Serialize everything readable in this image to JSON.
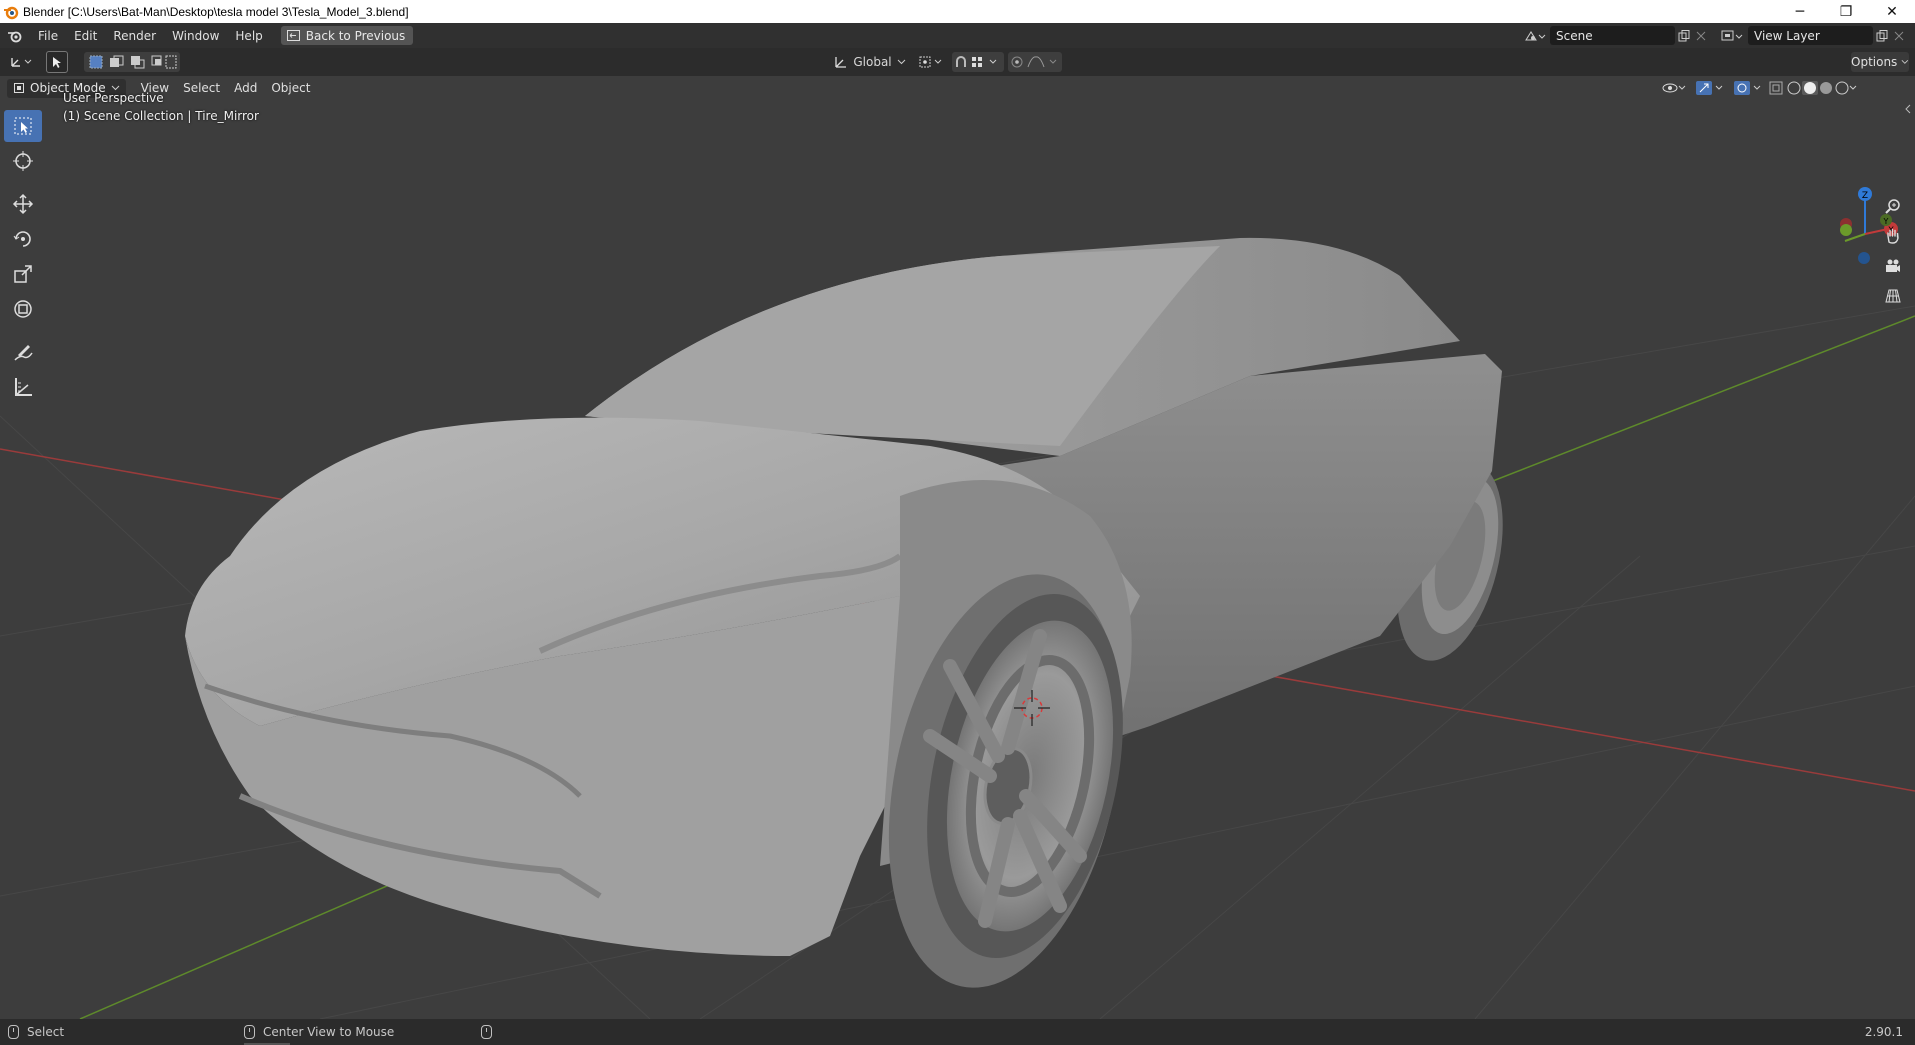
{
  "window": {
    "title": "Blender [C:\\Users\\Bat-Man\\Desktop\\tesla model 3\\Tesla_Model_3.blend]",
    "minimize_glyph": "─",
    "restore_glyph": "❐",
    "close_glyph": "✕"
  },
  "menu": {
    "items": [
      "File",
      "Edit",
      "Render",
      "Window",
      "Help"
    ],
    "back_label": "Back to Previous"
  },
  "scene": {
    "label": "Scene"
  },
  "view_layer": {
    "label": "View Layer"
  },
  "tool_settings": {
    "orientation": "Global",
    "options_label": "Options"
  },
  "viewport_header": {
    "mode": "Object Mode",
    "menus": [
      "View",
      "Select",
      "Add",
      "Object"
    ]
  },
  "overlay": {
    "view_name": "User Perspective",
    "collection": "(1) Scene Collection | Tire_Mirror"
  },
  "gizmo": {
    "z_label": "Z",
    "y_label": "Y",
    "x_label": "X"
  },
  "status": {
    "left": "Select",
    "middle": "Center View to Mouse",
    "version": "2.90.1"
  },
  "colors": {
    "active_tool": "#4772b3",
    "x_axis": "#c23a3a",
    "y_axis": "#6b9a2a",
    "z_axis": "#2f7ad8"
  }
}
